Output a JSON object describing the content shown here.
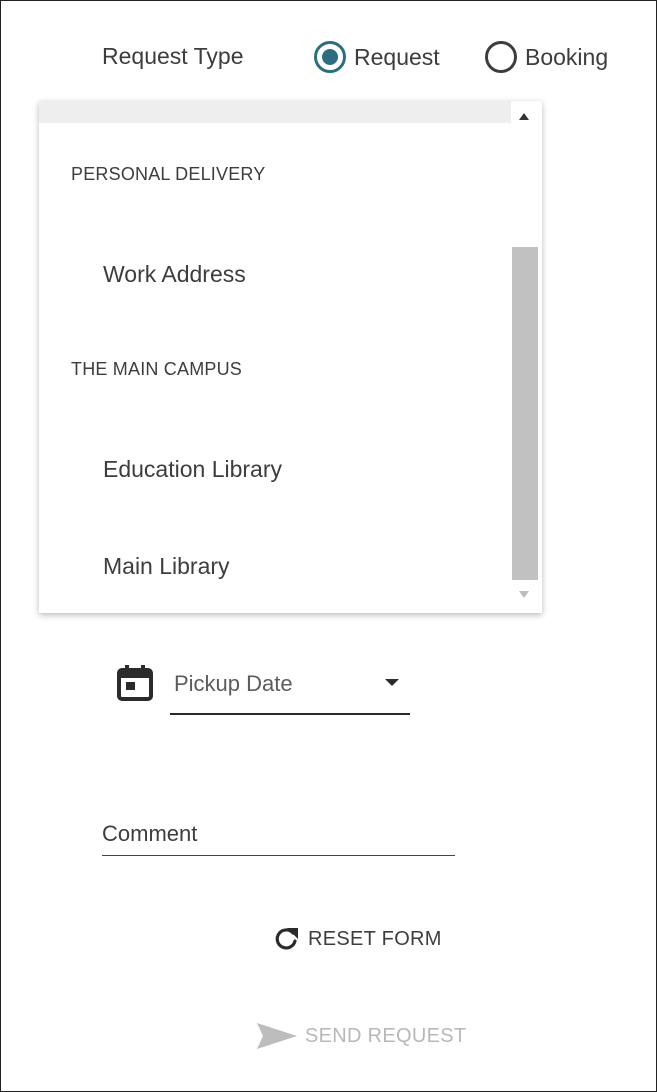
{
  "request_type": {
    "label": "Request Type",
    "options": [
      {
        "label": "Request",
        "selected": true
      },
      {
        "label": "Booking",
        "selected": false
      }
    ],
    "accent_color": "#2c6e7f"
  },
  "pickup_location_dropdown": {
    "groups": [
      {
        "label": "PERSONAL DELIVERY",
        "options": [
          "Work Address"
        ]
      },
      {
        "label": "THE MAIN CAMPUS",
        "options": [
          "Education Library",
          "Main Library"
        ]
      }
    ]
  },
  "pickup_date": {
    "placeholder": "Pickup Date",
    "icon": "calendar-icon"
  },
  "comment": {
    "placeholder": "Comment"
  },
  "actions": {
    "reset_label": "RESET FORM",
    "reset_icon": "refresh-icon",
    "send_label": "SEND REQUEST",
    "send_icon": "send-icon",
    "send_disabled": true
  }
}
